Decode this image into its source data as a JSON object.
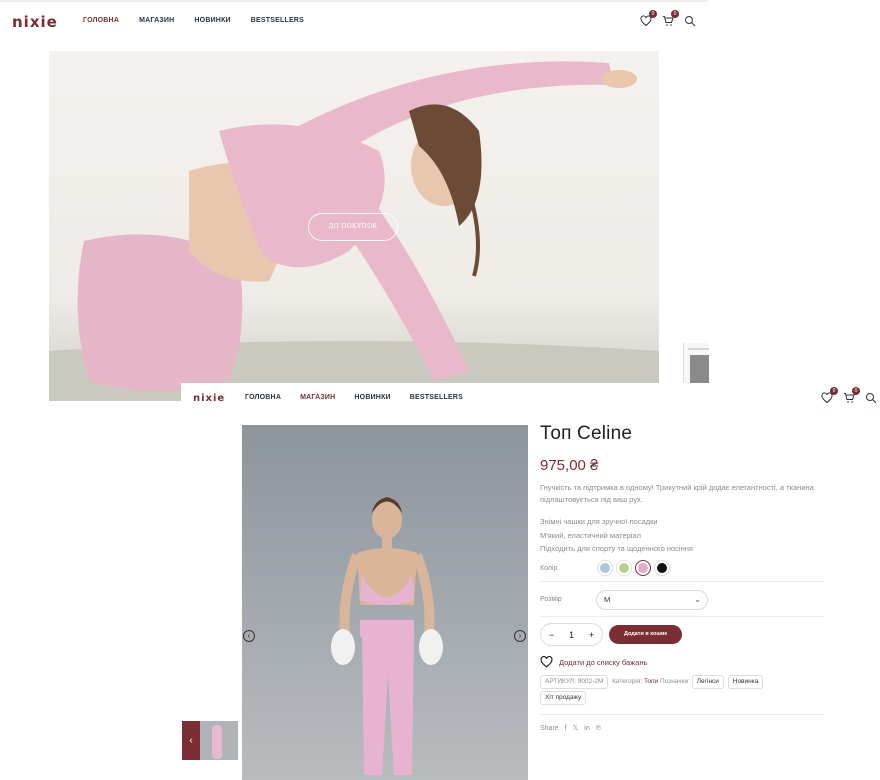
{
  "home": {
    "logo": "nixie",
    "nav": [
      "ГОЛОВНА",
      "МАГАЗИН",
      "НОВИНКИ",
      "BESTSELLERS"
    ],
    "active_nav": "ГОЛОВНА",
    "wishlist_count": "0",
    "cart_count": "0",
    "hero_button": "ДО ПОКУПОК"
  },
  "product_page": {
    "logo": "nixie",
    "nav": [
      "ГОЛОВНА",
      "МАГАЗИН",
      "НОВИНКИ",
      "BESTSELLERS"
    ],
    "active_nav": "МАГАЗИН",
    "wishlist_count": "0",
    "cart_count": "0",
    "title": "Топ Celine",
    "price": "975,00 ₴",
    "description": "Гнучкість та підтримка в одному! Трикутний крій додає елегантності, а тканина підлаштовується під ваш рух.",
    "features": [
      "Знімні чашки для зручної посадки",
      "М'який, еластичний матеріал",
      "Підходить для спорту та щоденного носіння"
    ],
    "color_label": "Колір",
    "colors": [
      "#a9c8dc",
      "#b9d08f",
      "#e3a9cd",
      "#111111"
    ],
    "selected_color_index": 2,
    "size_label": "Розмір",
    "size_value": "M",
    "quantity": "1",
    "minus": "−",
    "plus": "+",
    "add_to_cart": "Додати в кошик",
    "wishlist_label": "Додати до списку бажань",
    "sku": "АРТИКУЛ: 9002-2M",
    "category_label": "Категорія:",
    "category": "Топи",
    "tags_label": "Позначки:",
    "tags": [
      "Легінси",
      "Новинка",
      "Хіт продажу"
    ],
    "share_label": "Share",
    "share_icons": [
      "facebook-icon",
      "x-icon",
      "linkedin-icon",
      "pinterest-icon"
    ]
  }
}
